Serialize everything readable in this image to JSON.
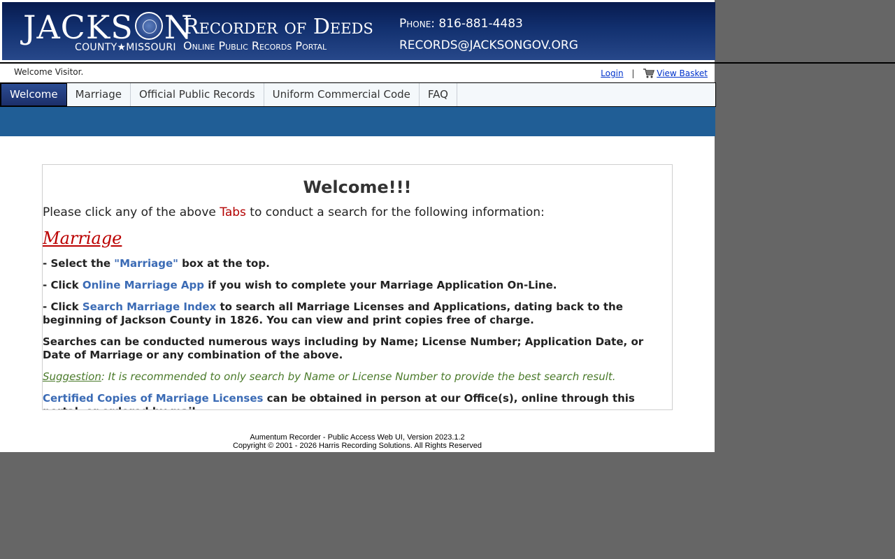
{
  "banner": {
    "brand_left": "JACKS",
    "brand_right": "N",
    "brand_sub": "COUNTY★MISSOURI",
    "title": "Recorder of Deeds",
    "portal": "Online Public Records Portal",
    "phone": "Phone: 816-881-4483",
    "email": "RECORDS@JACKSONGOV.ORG"
  },
  "user_bar": {
    "welcome": "Welcome Visitor.",
    "login": "Login",
    "separator": "|",
    "view_basket": "View Basket"
  },
  "nav": {
    "tabs": [
      "Welcome",
      "Marriage",
      "Official Public Records",
      "Uniform Commercial Code",
      "FAQ"
    ],
    "active": "Welcome"
  },
  "content": {
    "title": "Welcome!!!",
    "intro_before": "Please click any of the above ",
    "intro_tabs": "Tabs",
    "intro_after": " to conduct a search for the following information:",
    "section_heading": "Marriage",
    "line1_a": "- Select the ",
    "line1_link": "\"Marriage\"",
    "line1_b": " box at the top.",
    "line2_a": "- Click ",
    "line2_link": "Online Marriage App",
    "line2_b": " if you wish to complete your Marriage Application On-Line.",
    "line3_a": "- Click ",
    "line3_link": "Search Marriage Index",
    "line3_b": " to search all Marriage Licenses and Applications, dating back to the beginning of Jackson County in 1826. You can view and print copies free of charge.",
    "line4": "Searches can be conducted numerous ways including by Name; License Number; Application Date, or Date of Marriage or any combination of the above.",
    "suggestion_label": "Suggestion",
    "suggestion_text": ": It is recommended to only search by Name or License Number to provide the best search result.",
    "line6_link": "Certified Copies of Marriage Licenses",
    "line6_b": " can be obtained in person at our Office(s), online through this portal, or ordered by mail."
  },
  "footer": {
    "version": "Aumentum Recorder - Public Access Web UI, Version 2023.1.2",
    "copyright": "Copyright © 2001 - 2026  Harris Recording Solutions. All Rights Reserved"
  },
  "colors": {
    "banner": "#12306f",
    "strip": "#205e96",
    "background": "#666666",
    "link": "#3b6bb5",
    "accent_red": "#b30000"
  }
}
